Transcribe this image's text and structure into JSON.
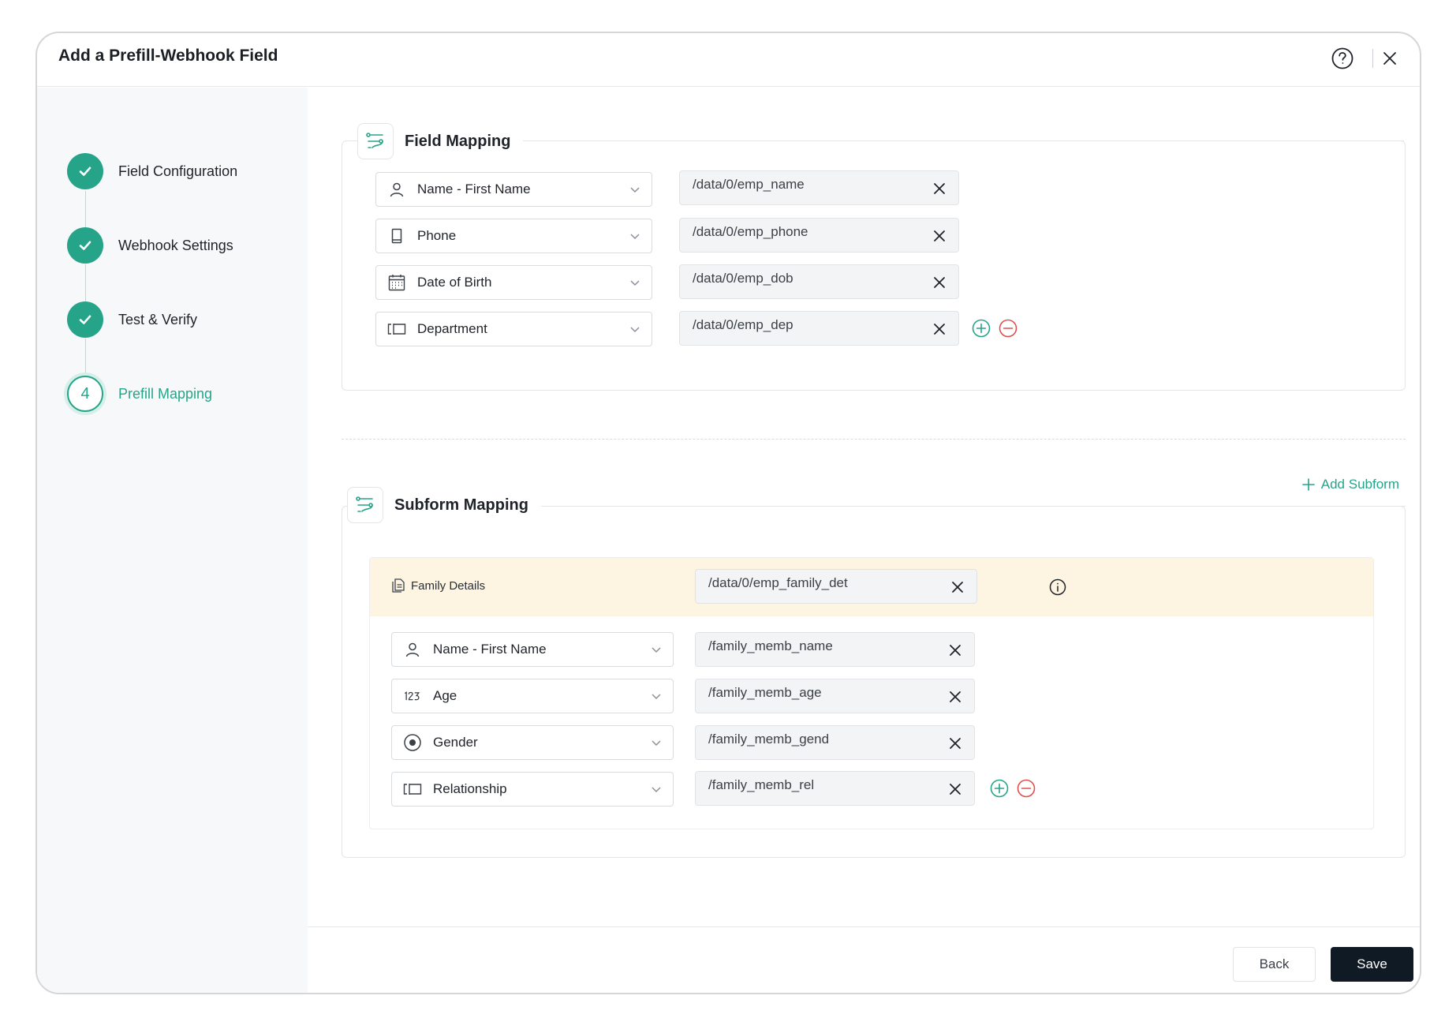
{
  "modal": {
    "title": "Add a Prefill-Webhook Field"
  },
  "steps": [
    {
      "label": "Field Configuration",
      "status": "done"
    },
    {
      "label": "Webhook Settings",
      "status": "done"
    },
    {
      "label": "Test & Verify",
      "status": "done"
    },
    {
      "label": "Prefill Mapping",
      "status": "active",
      "number": "4"
    }
  ],
  "field_mapping": {
    "title": "Field Mapping",
    "rows": [
      {
        "field": "Name - First Name",
        "icon": "person-icon",
        "path": "/data/0/emp_name"
      },
      {
        "field": "Phone",
        "icon": "phone-icon",
        "path": "/data/0/emp_phone"
      },
      {
        "field": "Date of Birth",
        "icon": "calendar-icon",
        "path": "/data/0/emp_dob"
      },
      {
        "field": "Department",
        "icon": "dropdown-field-icon",
        "path": "/data/0/emp_dep"
      }
    ]
  },
  "subform_mapping": {
    "title": "Subform Mapping",
    "add_label": "Add Subform",
    "subform": {
      "name": "Family Details",
      "path": "/data/0/emp_family_det",
      "rows": [
        {
          "field": "Name - First Name",
          "icon": "person-icon",
          "path": "/family_memb_name"
        },
        {
          "field": "Age",
          "icon": "number-icon",
          "path": "/family_memb_age"
        },
        {
          "field": "Gender",
          "icon": "radio-icon",
          "path": "/family_memb_gend"
        },
        {
          "field": "Relationship",
          "icon": "dropdown-field-icon",
          "path": "/family_memb_rel"
        }
      ]
    }
  },
  "footer": {
    "back_label": "Back",
    "save_label": "Save"
  },
  "colors": {
    "accent": "#26a48a",
    "danger": "#e0504b",
    "subform_bar": "#fdf5e2",
    "primary_button": "#0f1a24"
  }
}
